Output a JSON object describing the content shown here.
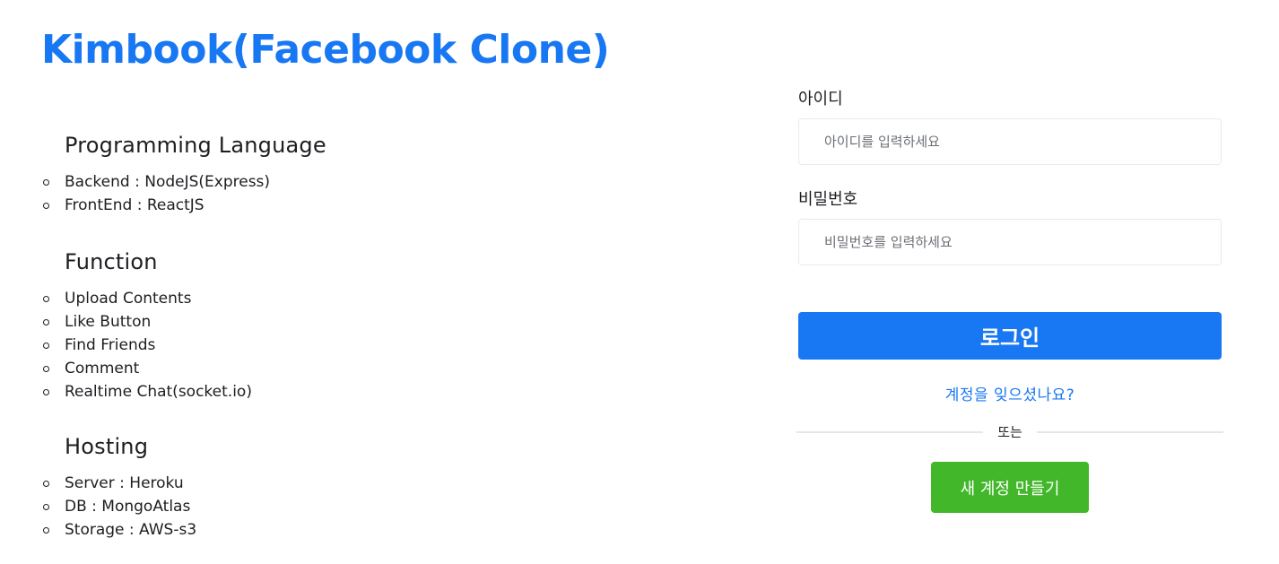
{
  "app": {
    "title": "Kimbook(Facebook Clone)"
  },
  "sections": [
    {
      "heading": "Programming Language",
      "items": [
        "Backend : NodeJS(Express)",
        "FrontEnd : ReactJS"
      ]
    },
    {
      "heading": "Function",
      "items": [
        "Upload Contents",
        "Like Button",
        "Find Friends",
        "Comment",
        "Realtime Chat(socket.io)"
      ]
    },
    {
      "heading": "Hosting",
      "items": [
        "Server : Heroku",
        "DB : MongoAtlas",
        "Storage : AWS-s3"
      ]
    }
  ],
  "login": {
    "id_label": "아이디",
    "id_placeholder": "아이디를 입력하세요",
    "id_value": "",
    "pw_label": "비밀번호",
    "pw_placeholder": "비밀번호를 입력하세요",
    "pw_value": "",
    "submit_label": "로그인",
    "forgot_label": "계정을 잊으셨나요?",
    "divider_label": "또는",
    "create_label": "새 계정 만들기"
  },
  "colors": {
    "brand": "#1877f2",
    "create": "#42b72a",
    "text": "#1c1e21",
    "border": "#e8eaed"
  }
}
